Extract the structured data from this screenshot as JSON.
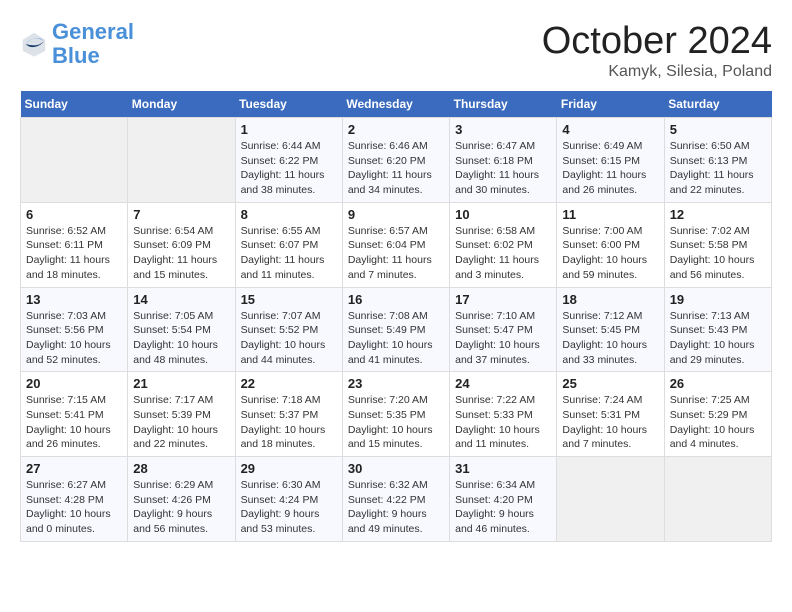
{
  "header": {
    "logo_line1": "General",
    "logo_line2": "Blue",
    "month": "October 2024",
    "location": "Kamyk, Silesia, Poland"
  },
  "weekdays": [
    "Sunday",
    "Monday",
    "Tuesday",
    "Wednesday",
    "Thursday",
    "Friday",
    "Saturday"
  ],
  "rows": [
    [
      {
        "day": "",
        "text": ""
      },
      {
        "day": "",
        "text": ""
      },
      {
        "day": "1",
        "text": "Sunrise: 6:44 AM\nSunset: 6:22 PM\nDaylight: 11 hours and 38 minutes."
      },
      {
        "day": "2",
        "text": "Sunrise: 6:46 AM\nSunset: 6:20 PM\nDaylight: 11 hours and 34 minutes."
      },
      {
        "day": "3",
        "text": "Sunrise: 6:47 AM\nSunset: 6:18 PM\nDaylight: 11 hours and 30 minutes."
      },
      {
        "day": "4",
        "text": "Sunrise: 6:49 AM\nSunset: 6:15 PM\nDaylight: 11 hours and 26 minutes."
      },
      {
        "day": "5",
        "text": "Sunrise: 6:50 AM\nSunset: 6:13 PM\nDaylight: 11 hours and 22 minutes."
      }
    ],
    [
      {
        "day": "6",
        "text": "Sunrise: 6:52 AM\nSunset: 6:11 PM\nDaylight: 11 hours and 18 minutes."
      },
      {
        "day": "7",
        "text": "Sunrise: 6:54 AM\nSunset: 6:09 PM\nDaylight: 11 hours and 15 minutes."
      },
      {
        "day": "8",
        "text": "Sunrise: 6:55 AM\nSunset: 6:07 PM\nDaylight: 11 hours and 11 minutes."
      },
      {
        "day": "9",
        "text": "Sunrise: 6:57 AM\nSunset: 6:04 PM\nDaylight: 11 hours and 7 minutes."
      },
      {
        "day": "10",
        "text": "Sunrise: 6:58 AM\nSunset: 6:02 PM\nDaylight: 11 hours and 3 minutes."
      },
      {
        "day": "11",
        "text": "Sunrise: 7:00 AM\nSunset: 6:00 PM\nDaylight: 10 hours and 59 minutes."
      },
      {
        "day": "12",
        "text": "Sunrise: 7:02 AM\nSunset: 5:58 PM\nDaylight: 10 hours and 56 minutes."
      }
    ],
    [
      {
        "day": "13",
        "text": "Sunrise: 7:03 AM\nSunset: 5:56 PM\nDaylight: 10 hours and 52 minutes."
      },
      {
        "day": "14",
        "text": "Sunrise: 7:05 AM\nSunset: 5:54 PM\nDaylight: 10 hours and 48 minutes."
      },
      {
        "day": "15",
        "text": "Sunrise: 7:07 AM\nSunset: 5:52 PM\nDaylight: 10 hours and 44 minutes."
      },
      {
        "day": "16",
        "text": "Sunrise: 7:08 AM\nSunset: 5:49 PM\nDaylight: 10 hours and 41 minutes."
      },
      {
        "day": "17",
        "text": "Sunrise: 7:10 AM\nSunset: 5:47 PM\nDaylight: 10 hours and 37 minutes."
      },
      {
        "day": "18",
        "text": "Sunrise: 7:12 AM\nSunset: 5:45 PM\nDaylight: 10 hours and 33 minutes."
      },
      {
        "day": "19",
        "text": "Sunrise: 7:13 AM\nSunset: 5:43 PM\nDaylight: 10 hours and 29 minutes."
      }
    ],
    [
      {
        "day": "20",
        "text": "Sunrise: 7:15 AM\nSunset: 5:41 PM\nDaylight: 10 hours and 26 minutes."
      },
      {
        "day": "21",
        "text": "Sunrise: 7:17 AM\nSunset: 5:39 PM\nDaylight: 10 hours and 22 minutes."
      },
      {
        "day": "22",
        "text": "Sunrise: 7:18 AM\nSunset: 5:37 PM\nDaylight: 10 hours and 18 minutes."
      },
      {
        "day": "23",
        "text": "Sunrise: 7:20 AM\nSunset: 5:35 PM\nDaylight: 10 hours and 15 minutes."
      },
      {
        "day": "24",
        "text": "Sunrise: 7:22 AM\nSunset: 5:33 PM\nDaylight: 10 hours and 11 minutes."
      },
      {
        "day": "25",
        "text": "Sunrise: 7:24 AM\nSunset: 5:31 PM\nDaylight: 10 hours and 7 minutes."
      },
      {
        "day": "26",
        "text": "Sunrise: 7:25 AM\nSunset: 5:29 PM\nDaylight: 10 hours and 4 minutes."
      }
    ],
    [
      {
        "day": "27",
        "text": "Sunrise: 6:27 AM\nSunset: 4:28 PM\nDaylight: 10 hours and 0 minutes."
      },
      {
        "day": "28",
        "text": "Sunrise: 6:29 AM\nSunset: 4:26 PM\nDaylight: 9 hours and 56 minutes."
      },
      {
        "day": "29",
        "text": "Sunrise: 6:30 AM\nSunset: 4:24 PM\nDaylight: 9 hours and 53 minutes."
      },
      {
        "day": "30",
        "text": "Sunrise: 6:32 AM\nSunset: 4:22 PM\nDaylight: 9 hours and 49 minutes."
      },
      {
        "day": "31",
        "text": "Sunrise: 6:34 AM\nSunset: 4:20 PM\nDaylight: 9 hours and 46 minutes."
      },
      {
        "day": "",
        "text": ""
      },
      {
        "day": "",
        "text": ""
      }
    ]
  ]
}
